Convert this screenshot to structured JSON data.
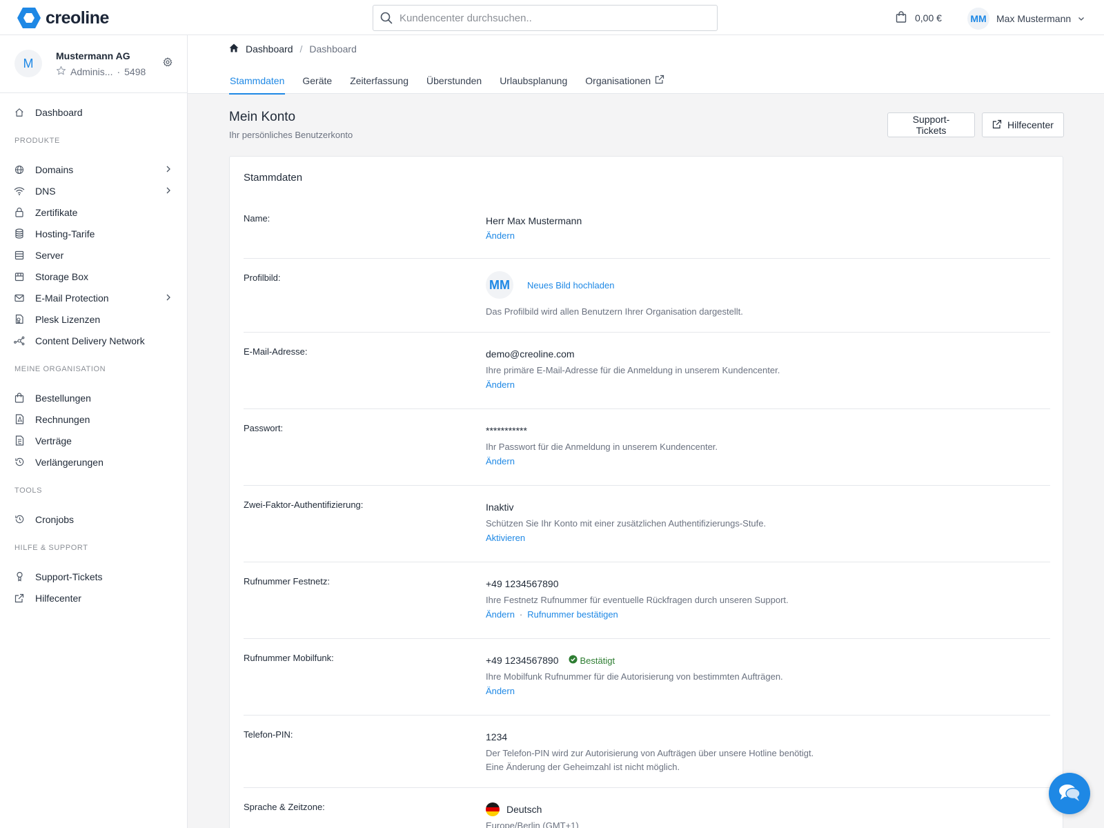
{
  "brand": {
    "name": "creoline",
    "color": "#1e88e5"
  },
  "search": {
    "placeholder": "Kundencenter durchsuchen.."
  },
  "cart": {
    "amount": "0,00 €",
    "icon": "shopping-bag-icon"
  },
  "user": {
    "initials": "MM",
    "name": "Max Mustermann"
  },
  "org": {
    "initial": "M",
    "name": "Mustermann AG",
    "role": "Adminis...",
    "separator": "·",
    "number": "5498"
  },
  "sidebar": {
    "dashboard": {
      "label": "Dashboard",
      "icon": "home-icon"
    },
    "sections": [
      {
        "title": "PRODUKTE",
        "items": [
          {
            "label": "Domains",
            "icon": "globe-icon"
          },
          {
            "label": "DNS",
            "icon": "wifi-icon"
          },
          {
            "label": "Zertifikate",
            "icon": "lock-icon"
          },
          {
            "label": "Hosting-Tarife",
            "icon": "database-icon"
          },
          {
            "label": "Server",
            "icon": "server-icon"
          },
          {
            "label": "Storage Box",
            "icon": "box-icon"
          },
          {
            "label": "E-Mail Protection",
            "icon": "mail-icon"
          },
          {
            "label": "Plesk Lizenzen",
            "icon": "license-icon"
          },
          {
            "label": "Content Delivery Network",
            "icon": "network-icon"
          }
        ]
      },
      {
        "title": "MEINE ORGANISATION",
        "items": [
          {
            "label": "Bestellungen",
            "icon": "bag-icon"
          },
          {
            "label": "Rechnungen",
            "icon": "pdf-file-icon"
          },
          {
            "label": "Verträge",
            "icon": "contract-icon"
          },
          {
            "label": "Verlängerungen",
            "icon": "history-icon"
          }
        ]
      },
      {
        "title": "TOOLS",
        "items": [
          {
            "label": "Cronjobs",
            "icon": "history-icon"
          }
        ]
      },
      {
        "title": "HILFE & SUPPORT",
        "items": [
          {
            "label": "Support-Tickets",
            "icon": "support-icon"
          },
          {
            "label": "Hilfecenter",
            "icon": "external-link-icon"
          }
        ]
      }
    ]
  },
  "breadcrumb": {
    "root": "Dashboard",
    "separator": "/",
    "current": "Dashboard"
  },
  "tabs": [
    "Stammdaten",
    "Geräte",
    "Zeiterfassung",
    "Überstunden",
    "Urlaubsplanung",
    "Organisationen"
  ],
  "page": {
    "title": "Mein Konto",
    "subtitle": "Ihr persönliches Benutzerkonto",
    "btn_support": "Support-Tickets",
    "btn_help": "Hilfecenter"
  },
  "card": {
    "title": "Stammdaten",
    "name": {
      "label": "Name:",
      "value": "Herr Max Mustermann",
      "action": "Ändern"
    },
    "profile": {
      "label": "Profilbild:",
      "initials": "MM",
      "upload": "Neues Bild hochladen",
      "desc": "Das Profilbild wird allen Benutzern Ihrer Organisation dargestellt."
    },
    "email": {
      "label": "E-Mail-Adresse:",
      "value": "demo@creoline.com",
      "desc": "Ihre primäre E-Mail-Adresse für die Anmeldung in unserem Kundencenter.",
      "action": "Ändern"
    },
    "password": {
      "label": "Passwort:",
      "value": "***********",
      "desc": "Ihr Passwort für die Anmeldung in unserem Kundencenter.",
      "action": "Ändern"
    },
    "twofa": {
      "label": "Zwei-Faktor-Authentifizierung:",
      "value": "Inaktiv",
      "desc": "Schützen Sie Ihr Konto mit einer zusätzlichen Authentifizierungs-Stufe.",
      "action": "Aktivieren"
    },
    "landline": {
      "label": "Rufnummer Festnetz:",
      "value": "+49 1234567890",
      "desc": "Ihre Festnetz Rufnummer für eventuelle Rückfragen durch unseren Support.",
      "action": "Ändern",
      "separator": "·",
      "action2": "Rufnummer bestätigen"
    },
    "mobile": {
      "label": "Rufnummer Mobilfunk:",
      "value": "+49 1234567890",
      "status": "Bestätigt",
      "status_color": "#2e7d32",
      "desc": "Ihre Mobilfunk Rufnummer für die Autorisierung von bestimmten Aufträgen.",
      "action": "Ändern"
    },
    "pin": {
      "label": "Telefon-PIN:",
      "value": "1234",
      "desc1": "Der Telefon-PIN wird zur Autorisierung von Aufträgen über unsere Hotline benötigt.",
      "desc2": "Eine Änderung der Geheimzahl ist nicht möglich."
    },
    "lang": {
      "label": "Sprache & Zeitzone:",
      "value": "Deutsch",
      "timezone": "Europe/Berlin (GMT+1)"
    }
  }
}
